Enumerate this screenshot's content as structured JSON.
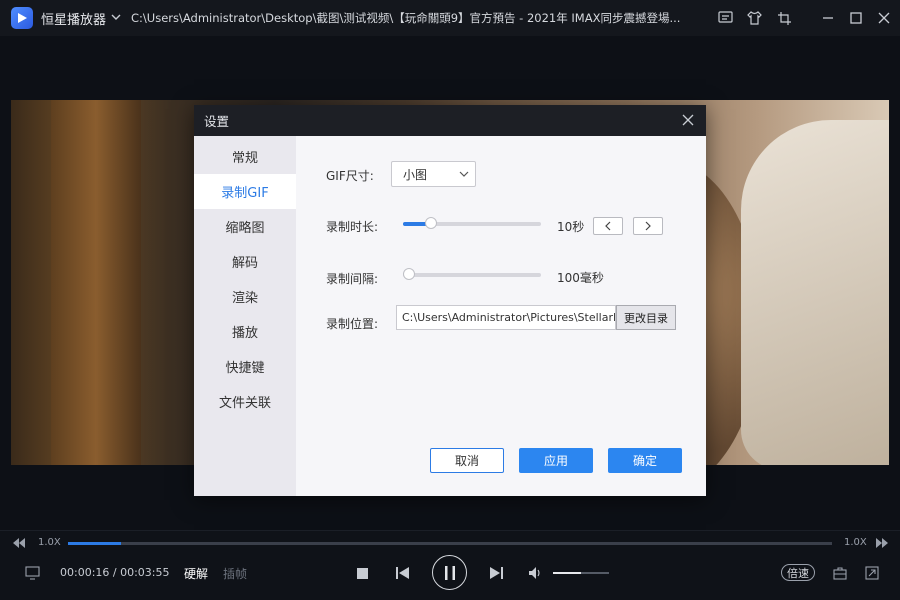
{
  "titlebar": {
    "app_name": "恒星播放器",
    "file_path": "C:\\Users\\Administrator\\Desktop\\截图\\测试视频\\【玩命關頭9】官方預告 - 2021年 IMAX同步震撼登場...",
    "icons": [
      "feedback-icon",
      "skin-icon",
      "crop-icon",
      "minimize-icon",
      "maximize-icon",
      "close-icon"
    ]
  },
  "dialog": {
    "title": "设置",
    "nav": [
      "常规",
      "录制GIF",
      "缩略图",
      "解码",
      "渲染",
      "播放",
      "快捷键",
      "文件关联"
    ],
    "active_nav_index": 1,
    "gif_size": {
      "label": "GIF尺寸:",
      "value": "小图"
    },
    "duration": {
      "label": "录制时长:",
      "value_text": "10秒",
      "level": 0.2
    },
    "interval": {
      "label": "录制间隔:",
      "value_text": "100毫秒",
      "level": 0.0
    },
    "location": {
      "label": "录制位置:",
      "path": "C:\\Users\\Administrator\\Pictures\\StellarPlayer",
      "change_button": "更改目录"
    },
    "buttons": {
      "cancel": "取消",
      "apply": "应用",
      "ok": "确定"
    }
  },
  "playback": {
    "speed_left": "1.0X",
    "speed_right": "1.0X",
    "progress": 0.07,
    "time": "00:00:16 / 00:03:55",
    "decode_mode": "硬解",
    "frame_step": "插帧",
    "volume": 0.5,
    "speed_button": "倍速"
  },
  "colors": {
    "accent": "#2c7be5",
    "dialog_header": "#1d1f25",
    "background": "#0d1016"
  }
}
